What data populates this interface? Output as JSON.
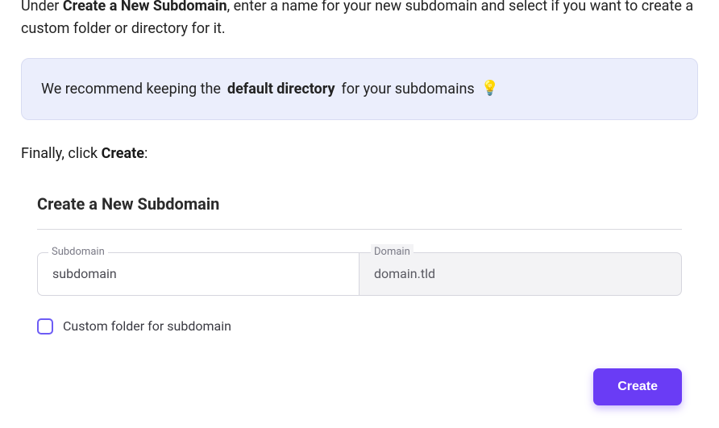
{
  "instruction": {
    "part1": "Under ",
    "bold1": "Create a New Subdomain",
    "part2": ", enter a name for your new subdomain and select if you want to create a custom folder or directory for it."
  },
  "callout": {
    "part1": "We recommend keeping the ",
    "bold": "default directory",
    "part2": " for your subdomains",
    "icon_name": "lightbulb-icon",
    "icon_glyph": "💡"
  },
  "final_line": {
    "part1": "Finally, click ",
    "bold": "Create",
    "part2": ":"
  },
  "panel": {
    "title": "Create a New Subdomain",
    "subdomain_field": {
      "label": "Subdomain",
      "value": "subdomain"
    },
    "domain_field": {
      "label": "Domain",
      "value": "domain.tld"
    },
    "checkbox": {
      "checked": false,
      "label": "Custom folder for subdomain"
    },
    "create_button": "Create"
  }
}
